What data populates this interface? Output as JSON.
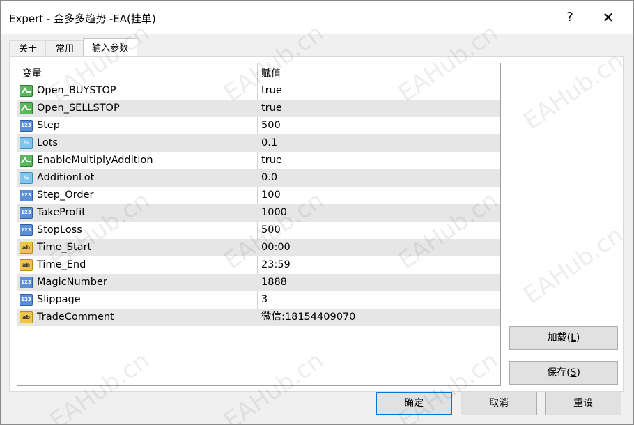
{
  "window": {
    "title": "Expert - 金多多趋势 -EA(挂单)",
    "help_label": "?",
    "close_label": "✕"
  },
  "tabs": [
    {
      "label": "关于"
    },
    {
      "label": "常用"
    },
    {
      "label": "输入参数"
    }
  ],
  "table": {
    "headers": [
      "变量",
      "赋值"
    ],
    "rows": [
      {
        "type": "bool",
        "icon": "bool-icon",
        "name": "Open_BUYSTOP",
        "value": "true"
      },
      {
        "type": "bool",
        "icon": "bool-icon",
        "name": "Open_SELLSTOP",
        "value": "true"
      },
      {
        "type": "int",
        "icon": "int-icon",
        "name": "Step",
        "value": "500"
      },
      {
        "type": "dbl",
        "icon": "double-icon",
        "name": "Lots",
        "value": "0.1"
      },
      {
        "type": "bool",
        "icon": "bool-icon",
        "name": "EnableMultiplyAddition",
        "value": "true"
      },
      {
        "type": "dbl",
        "icon": "double-icon",
        "name": "AdditionLot",
        "value": "0.0"
      },
      {
        "type": "int",
        "icon": "int-icon",
        "name": "Step_Order",
        "value": "100"
      },
      {
        "type": "int",
        "icon": "int-icon",
        "name": "TakeProfit",
        "value": "1000"
      },
      {
        "type": "int",
        "icon": "int-icon",
        "name": "StopLoss",
        "value": "500"
      },
      {
        "type": "str",
        "icon": "string-icon",
        "name": "Time_Start",
        "value": "00:00"
      },
      {
        "type": "str",
        "icon": "string-icon",
        "name": "Time_End",
        "value": "23:59"
      },
      {
        "type": "int",
        "icon": "int-icon",
        "name": "MagicNumber",
        "value": "1888"
      },
      {
        "type": "int",
        "icon": "int-icon",
        "name": "Slippage",
        "value": "3"
      },
      {
        "type": "str",
        "icon": "string-icon",
        "name": "TradeComment",
        "value": "微信:18154409070"
      }
    ]
  },
  "icons": {
    "int": "123",
    "dbl": "½",
    "str": "ab"
  },
  "buttons": {
    "load": {
      "text": "加载(",
      "key": "L",
      "end": ")"
    },
    "save": {
      "text": "保存(",
      "key": "S",
      "end": ")"
    },
    "ok": "确定",
    "cancel": "取消",
    "reset": "重设"
  },
  "watermark": "EAHub.cn",
  "colors": {
    "alt_row": "#e6e6e6",
    "bool_icon": "#5cb85c",
    "int_icon": "#5b8fd6",
    "double_icon": "#7ec4ec",
    "string_icon": "#f0c44c",
    "default_button_border": "#0078d7"
  }
}
